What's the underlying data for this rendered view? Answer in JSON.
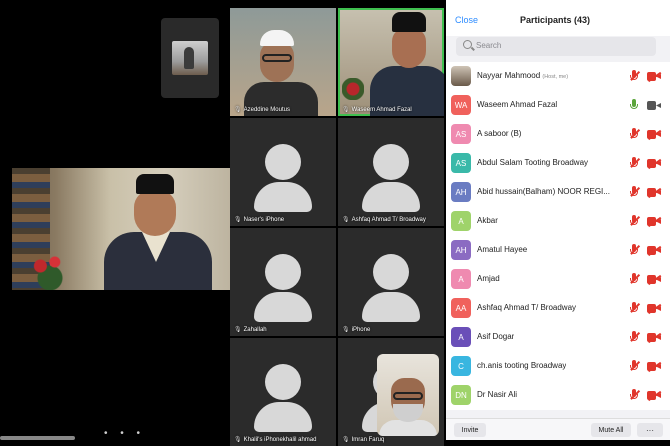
{
  "left_pane": {
    "page_dots": "• • •"
  },
  "grid": {
    "tiles": [
      {
        "name": "Azeddine Moutus",
        "type": "video-a"
      },
      {
        "name": "Waseem Ahmad Fazal",
        "type": "video-b",
        "active": true
      },
      {
        "name": "Naser's iPhone",
        "type": "avatar"
      },
      {
        "name": "Ashfaq Ahmad T/ Broadway",
        "type": "avatar"
      },
      {
        "name": "Zahallah",
        "type": "avatar"
      },
      {
        "name": "iPhone",
        "type": "avatar"
      },
      {
        "name": "Khalil's iPhonekhalil ahmad",
        "type": "avatar"
      },
      {
        "name": "Imran Faruq",
        "type": "avatar"
      }
    ]
  },
  "panel": {
    "close_label": "Close",
    "title": "Participants (43)",
    "search_placeholder": "Search",
    "invite_label": "Invite",
    "mute_all_label": "Mute All",
    "more_label": "···",
    "participants": [
      {
        "initials": "",
        "name": "Nayyar Mahmood",
        "tag": "(Host, me)",
        "color": "",
        "photo": true,
        "mic": "muted",
        "cam": "off"
      },
      {
        "initials": "WA",
        "name": "Waseem Ahmad Fazal",
        "tag": "",
        "color": "#f0615c",
        "mic": "on",
        "cam": "live"
      },
      {
        "initials": "AS",
        "name": "A saboor (B)",
        "tag": "",
        "color": "#ef8ab0",
        "mic": "muted",
        "cam": "off"
      },
      {
        "initials": "AS",
        "name": "Abdul Salam Tooting Broadway",
        "tag": "",
        "color": "#3ab9a9",
        "mic": "muted",
        "cam": "off"
      },
      {
        "initials": "AH",
        "name": "Abid hussain(Balham) NOOR REGI...",
        "tag": "",
        "color": "#6a7cc2",
        "mic": "muted",
        "cam": "off"
      },
      {
        "initials": "A",
        "name": "Akbar",
        "tag": "",
        "color": "#9fd36a",
        "mic": "muted",
        "cam": "off"
      },
      {
        "initials": "AH",
        "name": "Amatul Hayee",
        "tag": "",
        "color": "#8b6bc2",
        "mic": "muted",
        "cam": "off"
      },
      {
        "initials": "A",
        "name": "Amjad",
        "tag": "",
        "color": "#ef8ab0",
        "mic": "muted",
        "cam": "off"
      },
      {
        "initials": "AA",
        "name": "Ashfaq Ahmad T/ Broadway",
        "tag": "",
        "color": "#f0615c",
        "mic": "muted",
        "cam": "off"
      },
      {
        "initials": "A",
        "name": "Asif Dogar",
        "tag": "",
        "color": "#6a4fb8",
        "mic": "muted",
        "cam": "off"
      },
      {
        "initials": "C",
        "name": "ch.anis tooting Broadway",
        "tag": "",
        "color": "#39b6e0",
        "mic": "muted",
        "cam": "off"
      },
      {
        "initials": "DN",
        "name": "Dr Nasir Ali",
        "tag": "",
        "color": "#9fd36a",
        "mic": "muted",
        "cam": "off"
      }
    ]
  }
}
